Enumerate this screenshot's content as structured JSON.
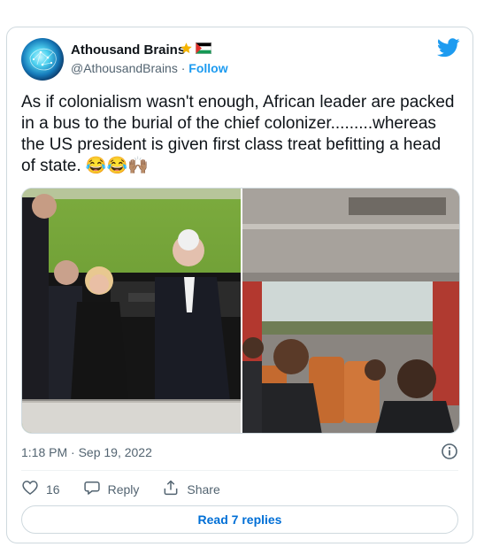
{
  "author": {
    "name": "Athousand Brains",
    "handle": "@AthousandBrains",
    "separator": "·",
    "follow_label": "Follow"
  },
  "tweet": {
    "text": "As if colonialism wasn't enough, African leader are packed in a bus to the burial of the chief colonizer.........whereas the US president is given first class treat befitting a head of state. 😂😂🙌🏽"
  },
  "meta": {
    "timestamp": "1:18 PM · Sep 19, 2022"
  },
  "actions": {
    "like_count": "16",
    "reply_label": "Reply",
    "share_label": "Share"
  },
  "replies": {
    "label": "Read 7 replies"
  },
  "icons": {
    "logo": "twitter-bird-icon",
    "info": "info-icon",
    "like": "heart-icon",
    "reply": "reply-bubble-icon",
    "share": "share-icon",
    "badges": [
      "star-icon",
      "palestine-flag-icon"
    ]
  },
  "colors": {
    "brand": "#1d9bf0",
    "link": "#006fd6",
    "text": "#0f1419",
    "muted": "#536471",
    "border": "#cfd9de"
  }
}
